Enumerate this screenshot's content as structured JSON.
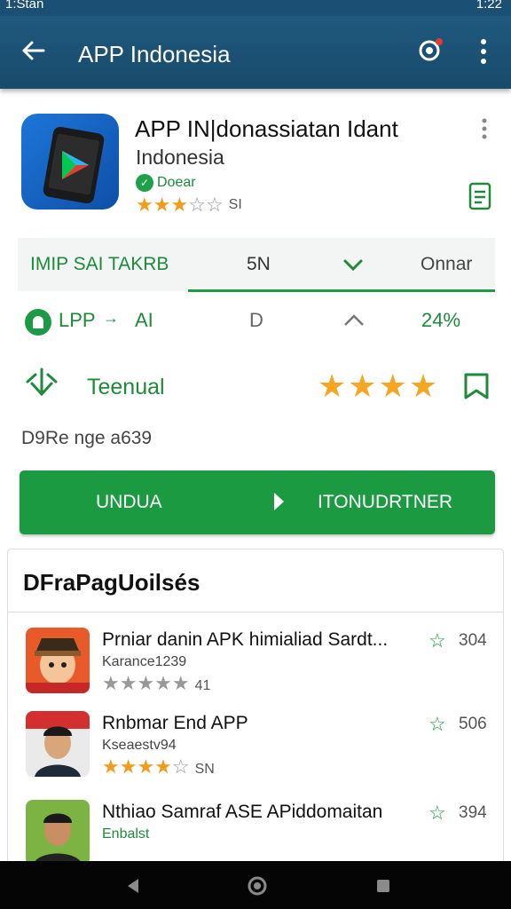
{
  "status": {
    "time_left": "1:Stan",
    "time_right": "1:22"
  },
  "app_bar": {
    "title": "APP Indonesia"
  },
  "header": {
    "app_name": "APP IN|donassiatan Idant",
    "developer": "Indonesia",
    "badge_label": "Doear",
    "rating_count": "SI",
    "rating": 3
  },
  "tabs": [
    "IMIP SAI TAKRB",
    "5N",
    "Onnar"
  ],
  "info_row": {
    "left_label": "LPP",
    "arrow": "→",
    "mid": "AI",
    "d": "D",
    "percent": "24%"
  },
  "feature": {
    "label": "Teenual",
    "stars": 4
  },
  "size_text": "D9Re nge a639",
  "install": {
    "left": "UNDUA",
    "right": "ITONUDRTNER"
  },
  "list": {
    "title": "DFraPagUoilsés",
    "items": [
      {
        "title": "Prniar danin APK himialiad Sardt...",
        "sub": "Karance1239",
        "rating_count": "41",
        "count": "304",
        "stars": 0
      },
      {
        "title": "Rnbmar End APP",
        "sub": "Kseaestv94",
        "rating_count": "SN",
        "count": "506",
        "stars": 4
      },
      {
        "title": "Nthiao Samraf ASE APiddomaitan",
        "sub": "Enbalst",
        "rating_count": "",
        "count": "394",
        "stars": 0
      }
    ]
  },
  "colors": {
    "accent": "#1b9a42",
    "app_bar": "#1e577c",
    "star": "#f5a623"
  }
}
